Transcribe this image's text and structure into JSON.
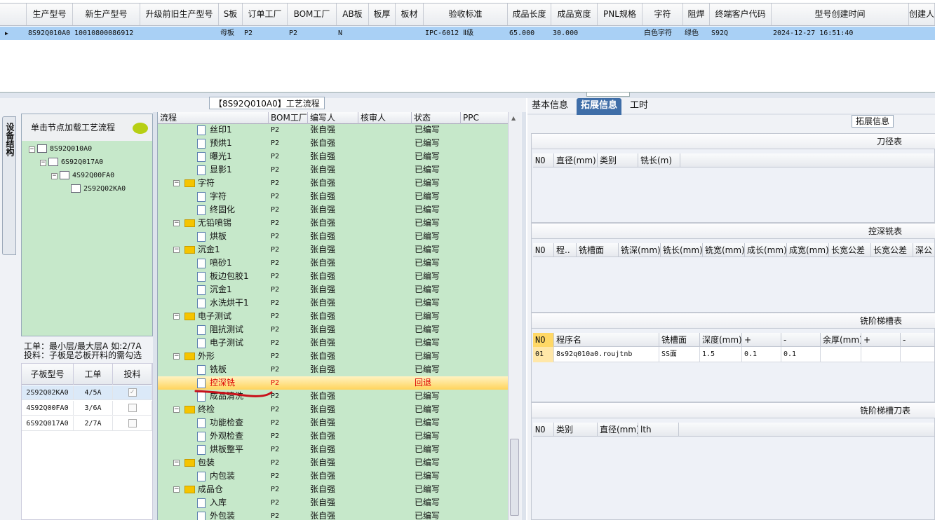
{
  "top_grid": {
    "columns": [
      "生产型号",
      "新生产型号",
      "升级前旧生产型号",
      "S板",
      "订单工厂",
      "BOM工厂",
      "AB板",
      "板厚",
      "板材",
      "验收标准",
      "成品长度",
      "成品宽度",
      "PNL规格",
      "字符",
      "阻焊",
      "终端客户代码",
      "型号创建时间",
      "创建人"
    ],
    "row": [
      "8S92Q010A0",
      "10010800086912",
      "",
      "母板",
      "P2",
      "P2",
      "N",
      "",
      "",
      "IPC-6012 Ⅱ级",
      "65.000",
      "30.000",
      "",
      "白色字符",
      "绿色",
      "S92Q",
      "2024-12-27 16:51:40",
      ""
    ]
  },
  "left_panel": {
    "title": "【8S92Q010A0】工艺流程",
    "vertical_tab": "设备结构",
    "node_header": "单击节点加载工艺流程",
    "tree": [
      "8S92Q010A0",
      "6S92Q017A0",
      "4S92Q00FA0",
      "2S92Q02KA0"
    ],
    "info_line1": "工单：最小层/最大层A 如:2/7A",
    "info_line2": "投料：子板是芯板开料的需勾选",
    "sub_columns": [
      "子板型号",
      "工单",
      "投料"
    ],
    "sub_rows": [
      {
        "model": "2S92Q02KA0",
        "order": "4/5A",
        "checked": true
      },
      {
        "model": "4S92Q00FA0",
        "order": "3/6A",
        "checked": false
      },
      {
        "model": "6S92Q017A0",
        "order": "2/7A",
        "checked": false
      }
    ]
  },
  "flow": {
    "columns": [
      "流程",
      "BOM工厂",
      "编写人",
      "核审人",
      "状态",
      "PPC"
    ],
    "rows": [
      {
        "name": "丝印1",
        "level": 2,
        "bom": "P2",
        "writer": "张自强",
        "status": "已编写"
      },
      {
        "name": "预烘1",
        "level": 2,
        "bom": "P2",
        "writer": "张自强",
        "status": "已编写"
      },
      {
        "name": "曝光1",
        "level": 2,
        "bom": "P2",
        "writer": "张自强",
        "status": "已编写"
      },
      {
        "name": "显影1",
        "level": 2,
        "bom": "P2",
        "writer": "张自强",
        "status": "已编写"
      },
      {
        "name": "字符",
        "level": 1,
        "bom": "P2",
        "writer": "张自强",
        "status": "已编写"
      },
      {
        "name": "字符",
        "level": 2,
        "bom": "P2",
        "writer": "张自强",
        "status": "已编写"
      },
      {
        "name": "终固化",
        "level": 2,
        "bom": "P2",
        "writer": "张自强",
        "status": "已编写"
      },
      {
        "name": "无铅喷锡",
        "level": 1,
        "bom": "P2",
        "writer": "张自强",
        "status": "已编写"
      },
      {
        "name": "烘板",
        "level": 2,
        "bom": "P2",
        "writer": "张自强",
        "status": "已编写"
      },
      {
        "name": "沉金1",
        "level": 1,
        "bom": "P2",
        "writer": "张自强",
        "status": "已编写"
      },
      {
        "name": "喷砂1",
        "level": 2,
        "bom": "P2",
        "writer": "张自强",
        "status": "已编写"
      },
      {
        "name": "板边包胶1",
        "level": 2,
        "bom": "P2",
        "writer": "张自强",
        "status": "已编写"
      },
      {
        "name": "沉金1",
        "level": 2,
        "bom": "P2",
        "writer": "张自强",
        "status": "已编写"
      },
      {
        "name": "水洗烘干1",
        "level": 2,
        "bom": "P2",
        "writer": "张自强",
        "status": "已编写"
      },
      {
        "name": "电子测试",
        "level": 1,
        "bom": "P2",
        "writer": "张自强",
        "status": "已编写"
      },
      {
        "name": "阻抗测试",
        "level": 2,
        "bom": "P2",
        "writer": "张自强",
        "status": "已编写"
      },
      {
        "name": "电子测试",
        "level": 2,
        "bom": "P2",
        "writer": "张自强",
        "status": "已编写"
      },
      {
        "name": "外形",
        "level": 1,
        "bom": "P2",
        "writer": "张自强",
        "status": "已编写"
      },
      {
        "name": "铣板",
        "level": 2,
        "bom": "P2",
        "writer": "张自强",
        "status": "已编写"
      },
      {
        "name": "控深铣",
        "level": 2,
        "bom": "P2",
        "writer": "",
        "status": "回退",
        "selected": true
      },
      {
        "name": "成品清洗",
        "level": 2,
        "bom": "P2",
        "writer": "张自强",
        "status": "已编写"
      },
      {
        "name": "终检",
        "level": 1,
        "bom": "P2",
        "writer": "张自强",
        "status": "已编写"
      },
      {
        "name": "功能检查",
        "level": 2,
        "bom": "P2",
        "writer": "张自强",
        "status": "已编写"
      },
      {
        "name": "外观检查",
        "level": 2,
        "bom": "P2",
        "writer": "张自强",
        "status": "已编写"
      },
      {
        "name": "烘板整平",
        "level": 2,
        "bom": "P2",
        "writer": "张自强",
        "status": "已编写"
      },
      {
        "name": "包装",
        "level": 1,
        "bom": "P2",
        "writer": "张自强",
        "status": "已编写"
      },
      {
        "name": "内包装",
        "level": 2,
        "bom": "P2",
        "writer": "张自强",
        "status": "已编写"
      },
      {
        "name": "成品仓",
        "level": 1,
        "bom": "P2",
        "writer": "张自强",
        "status": "已编写"
      },
      {
        "name": "入库",
        "level": 2,
        "bom": "P2",
        "writer": "张自强",
        "status": "已编写"
      },
      {
        "name": "外包装",
        "level": 2,
        "bom": "P2",
        "writer": "张自强",
        "status": "已编写"
      }
    ]
  },
  "right_panel": {
    "tabs": [
      "基本信息",
      "拓展信息",
      "工时"
    ],
    "ext_title": "拓展信息",
    "sections": [
      {
        "title": "刀径表",
        "columns": [
          "NO",
          "直径(mm)",
          "类别",
          "铣长(m)"
        ]
      },
      {
        "title": "控深铣表",
        "columns": [
          "NO",
          "程..",
          "铣槽面",
          "铣深(mm)",
          "铣长(mm)",
          "铣宽(mm)",
          "成长(mm)",
          "成宽(mm)",
          "长宽公差",
          "长宽公差",
          "深公"
        ]
      },
      {
        "title": "铣阶梯槽表",
        "columns": [
          "NO",
          "程序名",
          "铣槽面",
          "深度(mm)",
          "+",
          "-",
          "余厚(mm)",
          "+",
          "-"
        ],
        "row": [
          "01",
          "8s92q010a0.roujtnb",
          "SS面",
          "1.5",
          "0.1",
          "0.1",
          "",
          "",
          ""
        ]
      },
      {
        "title": "铣阶梯槽刀表",
        "columns": [
          "NO",
          "类别",
          "直径(mm)",
          "lth"
        ]
      }
    ]
  },
  "colors": {
    "accent": "#3f6ea8",
    "selected_row": "#a9d0f5",
    "tree_bg": "#c6e8ca",
    "status_back": "#dd0000"
  }
}
